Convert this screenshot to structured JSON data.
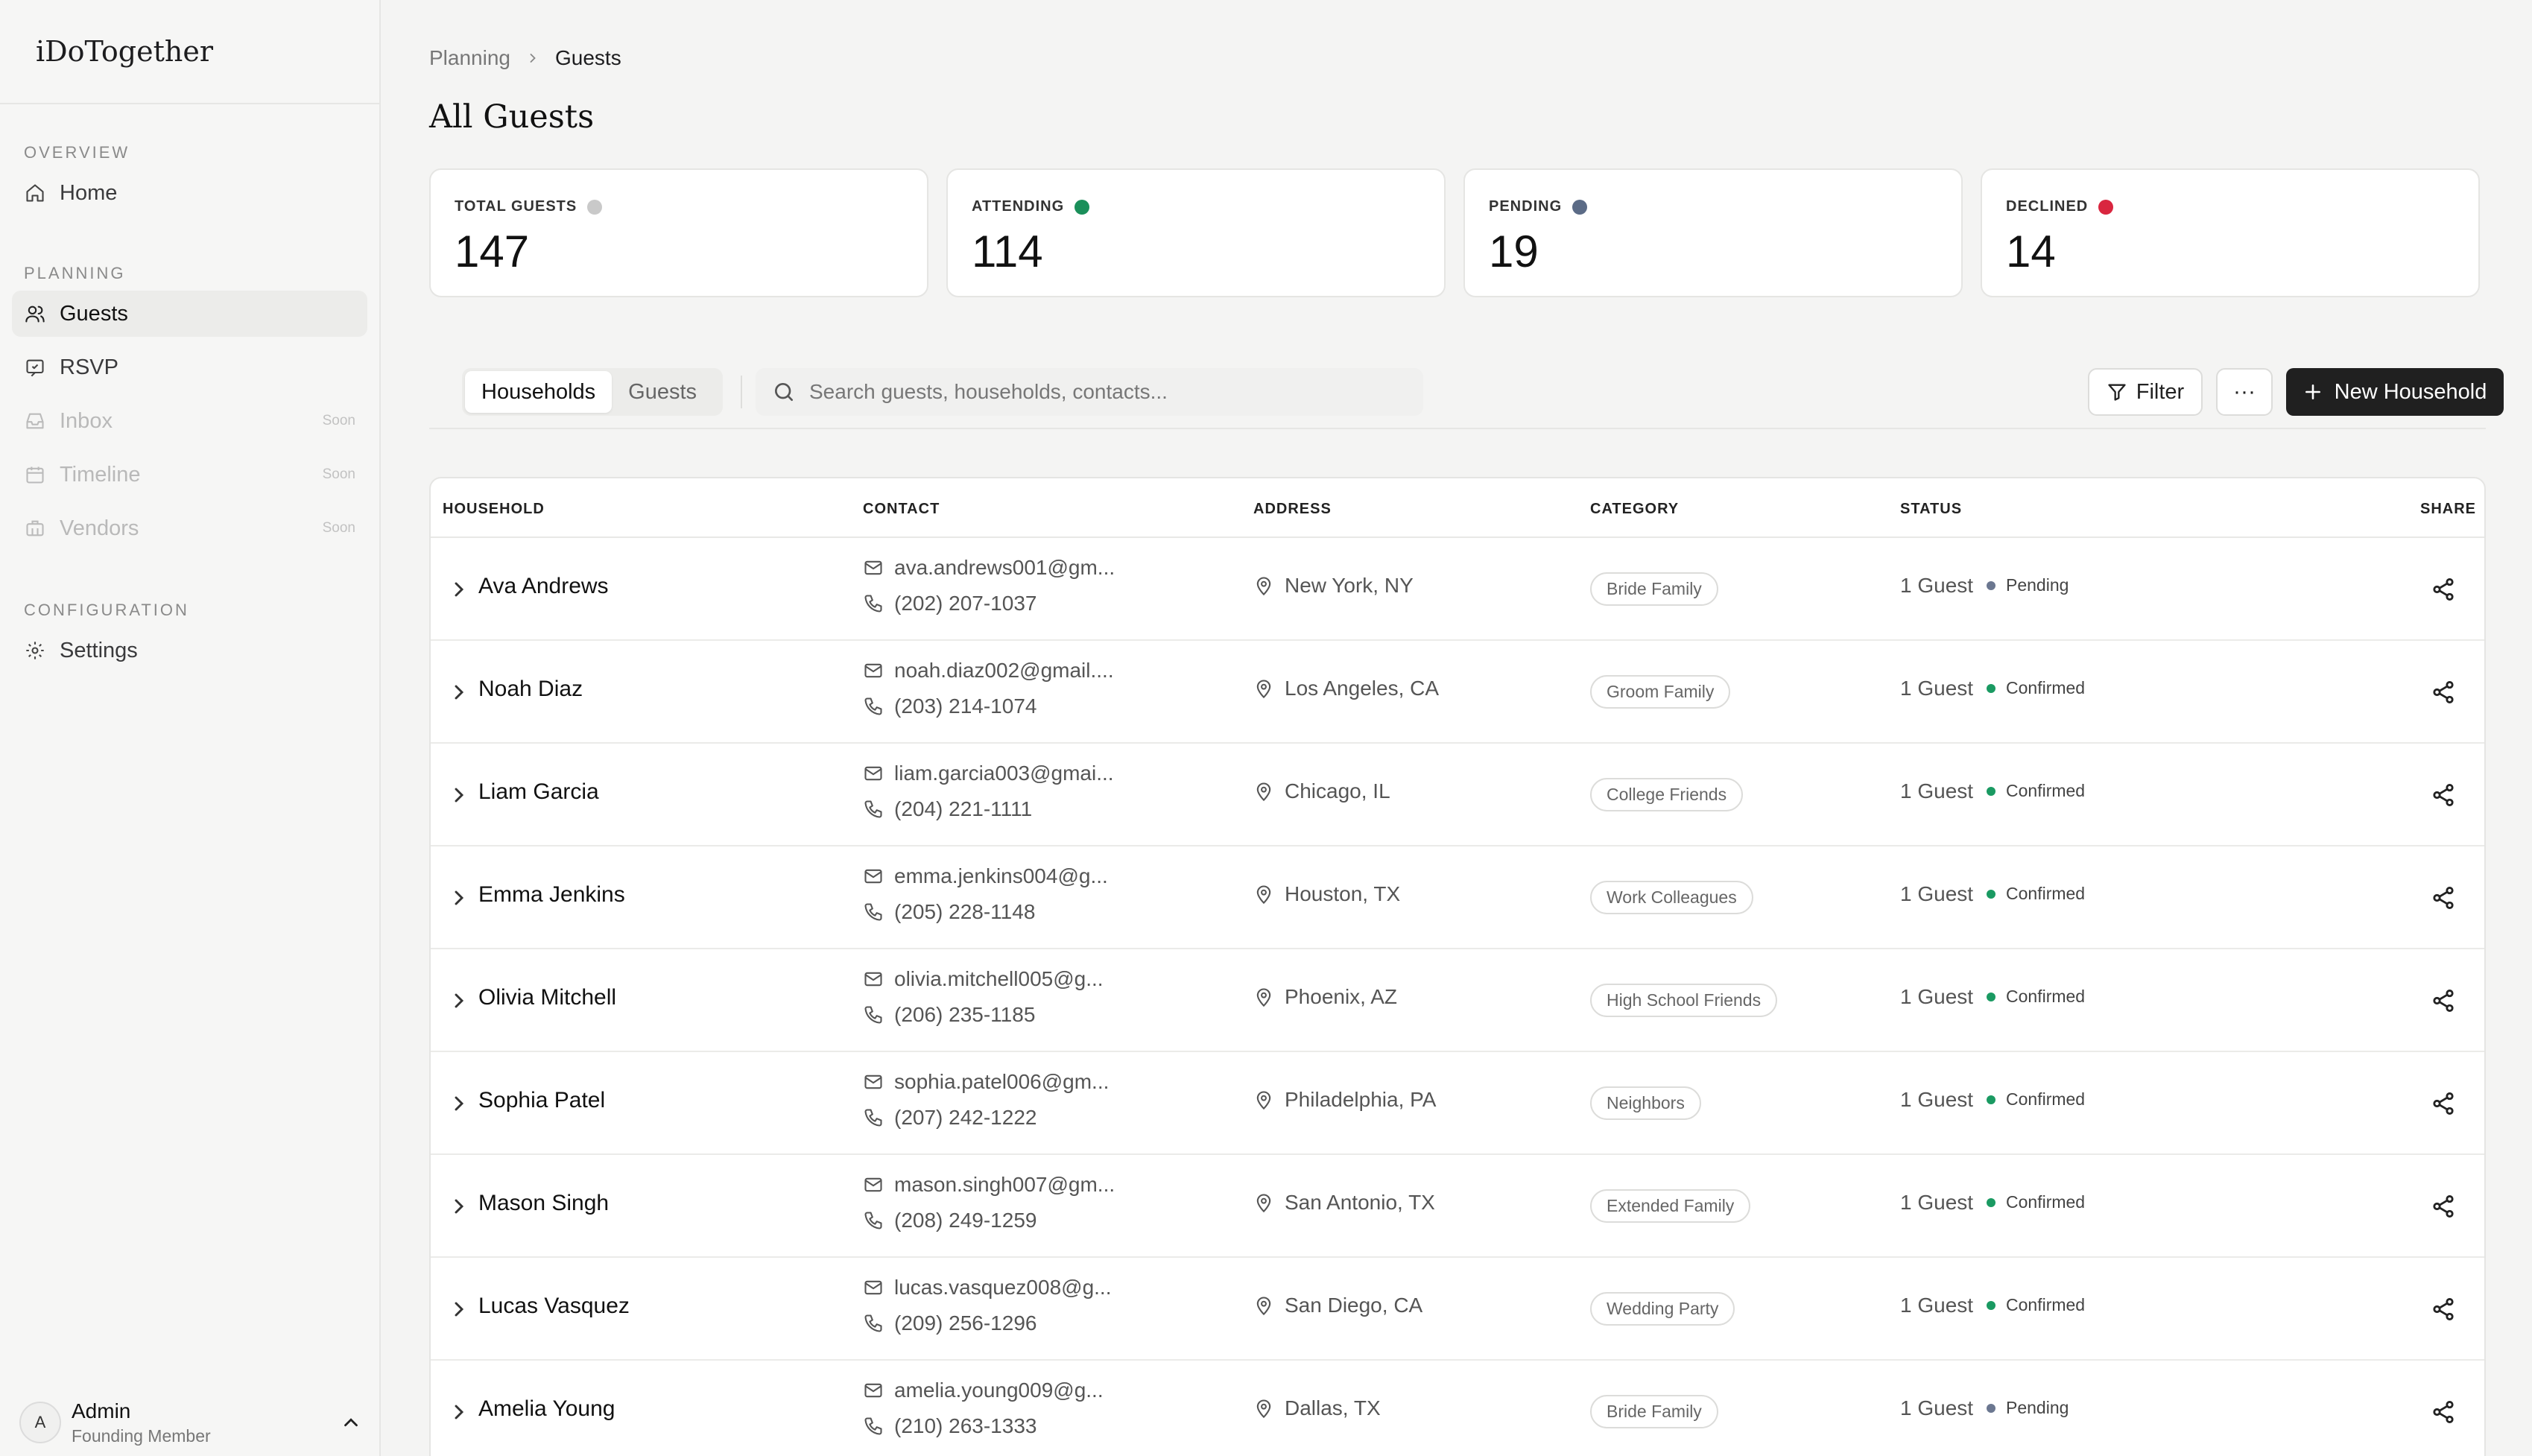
{
  "app": {
    "name": "iDoTogether"
  },
  "sidebar": {
    "sections": {
      "overview": "OVERVIEW",
      "planning": "PLANNING",
      "configuration": "CONFIGURATION"
    },
    "items": {
      "home": {
        "label": "Home",
        "icon": "home-icon"
      },
      "guests": {
        "label": "Guests",
        "icon": "users-icon",
        "active": true
      },
      "rsvp": {
        "label": "RSVP",
        "icon": "message-icon"
      },
      "inbox": {
        "label": "Inbox",
        "icon": "inbox-icon",
        "badge": "Soon"
      },
      "timeline": {
        "label": "Timeline",
        "icon": "calendar-icon",
        "badge": "Soon"
      },
      "vendors": {
        "label": "Vendors",
        "icon": "briefcase-icon",
        "badge": "Soon"
      },
      "settings": {
        "label": "Settings",
        "icon": "gear-icon"
      }
    },
    "user": {
      "initial": "A",
      "name": "Admin",
      "role": "Founding Member"
    }
  },
  "breadcrumb": {
    "parent": "Planning",
    "current": "Guests"
  },
  "page": {
    "title": "All Guests"
  },
  "stats": [
    {
      "label": "TOTAL GUESTS",
      "value": "147",
      "color": "#c9c9c9"
    },
    {
      "label": "ATTENDING",
      "value": "114",
      "color": "#1a8f5a"
    },
    {
      "label": "PENDING",
      "value": "19",
      "color": "#5b6b86"
    },
    {
      "label": "DECLINED",
      "value": "14",
      "color": "#d9263f"
    }
  ],
  "toolbar": {
    "tabs": [
      "Households",
      "Guests"
    ],
    "active_tab": "Households",
    "search_placeholder": "Search guests, households, contacts...",
    "filter_label": "Filter",
    "more_label": "···",
    "new_label": "New Household"
  },
  "table": {
    "headers": {
      "household": "HOUSEHOLD",
      "contact": "CONTACT",
      "address": "ADDRESS",
      "category": "CATEGORY",
      "status": "STATUS",
      "share": "SHARE"
    },
    "rows": [
      {
        "name": "Ava Andrews",
        "email": "ava.andrews001@gm...",
        "phone": "(202) 207-1037",
        "address": "New York, NY",
        "category": "Bride Family",
        "guests": "1 Guest",
        "status": "Pending"
      },
      {
        "name": "Noah Diaz",
        "email": "noah.diaz002@gmail....",
        "phone": "(203) 214-1074",
        "address": "Los Angeles, CA",
        "category": "Groom Family",
        "guests": "1 Guest",
        "status": "Confirmed"
      },
      {
        "name": "Liam Garcia",
        "email": "liam.garcia003@gmai...",
        "phone": "(204) 221-1111",
        "address": "Chicago, IL",
        "category": "College Friends",
        "guests": "1 Guest",
        "status": "Confirmed"
      },
      {
        "name": "Emma Jenkins",
        "email": "emma.jenkins004@g...",
        "phone": "(205) 228-1148",
        "address": "Houston, TX",
        "category": "Work Colleagues",
        "guests": "1 Guest",
        "status": "Confirmed"
      },
      {
        "name": "Olivia Mitchell",
        "email": "olivia.mitchell005@g...",
        "phone": "(206) 235-1185",
        "address": "Phoenix, AZ",
        "category": "High School Friends",
        "guests": "1 Guest",
        "status": "Confirmed"
      },
      {
        "name": "Sophia Patel",
        "email": "sophia.patel006@gm...",
        "phone": "(207) 242-1222",
        "address": "Philadelphia, PA",
        "category": "Neighbors",
        "guests": "1 Guest",
        "status": "Confirmed"
      },
      {
        "name": "Mason Singh",
        "email": "mason.singh007@gm...",
        "phone": "(208) 249-1259",
        "address": "San Antonio, TX",
        "category": "Extended Family",
        "guests": "1 Guest",
        "status": "Confirmed"
      },
      {
        "name": "Lucas Vasquez",
        "email": "lucas.vasquez008@g...",
        "phone": "(209) 256-1296",
        "address": "San Diego, CA",
        "category": "Wedding Party",
        "guests": "1 Guest",
        "status": "Confirmed"
      },
      {
        "name": "Amelia Young",
        "email": "amelia.young009@g...",
        "phone": "(210) 263-1333",
        "address": "Dallas, TX",
        "category": "Bride Family",
        "guests": "1 Guest",
        "status": "Pending"
      }
    ]
  },
  "colors": {
    "confirmed": "#1a9a62",
    "pending": "#6b7790"
  }
}
